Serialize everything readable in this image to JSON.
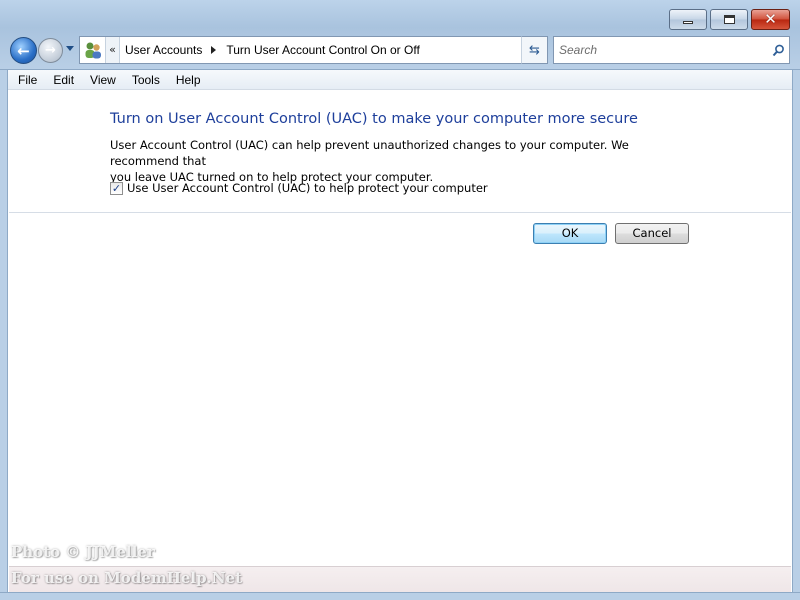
{
  "window": {
    "caption_buttons": {
      "minimize": "minimize-icon",
      "maximize": "maximize-icon",
      "close": "close-icon"
    },
    "close_glyph": "✕"
  },
  "navigation": {
    "back_glyph": "←",
    "forward_glyph": "→"
  },
  "address_bar": {
    "overflow_glyph": "«",
    "breadcrumbs": [
      "User Accounts",
      "Turn User Account Control On or Off"
    ],
    "refresh_glyph": "⇆"
  },
  "search": {
    "placeholder": "Search"
  },
  "menu": {
    "items": [
      "File",
      "Edit",
      "View",
      "Tools",
      "Help"
    ]
  },
  "main": {
    "heading": "Turn on User Account Control (UAC) to make your computer more secure",
    "description_line1": "User Account Control (UAC) can help prevent unauthorized changes to your computer.  We recommend that",
    "description_line2": "you leave UAC turned on to help protect your computer.",
    "checkbox": {
      "label": "Use User Account Control (UAC) to help protect your computer",
      "checked": true,
      "check_glyph": "✓"
    }
  },
  "buttons": {
    "ok_label": "OK",
    "cancel_label": "Cancel"
  },
  "watermark": {
    "line1": "Photo © JJMeller",
    "line2": "For use on ModemHelp.Net"
  },
  "colors": {
    "heading": "#1e3f9b",
    "chrome": "#b9cfe6",
    "close_button": "#c8351c"
  }
}
